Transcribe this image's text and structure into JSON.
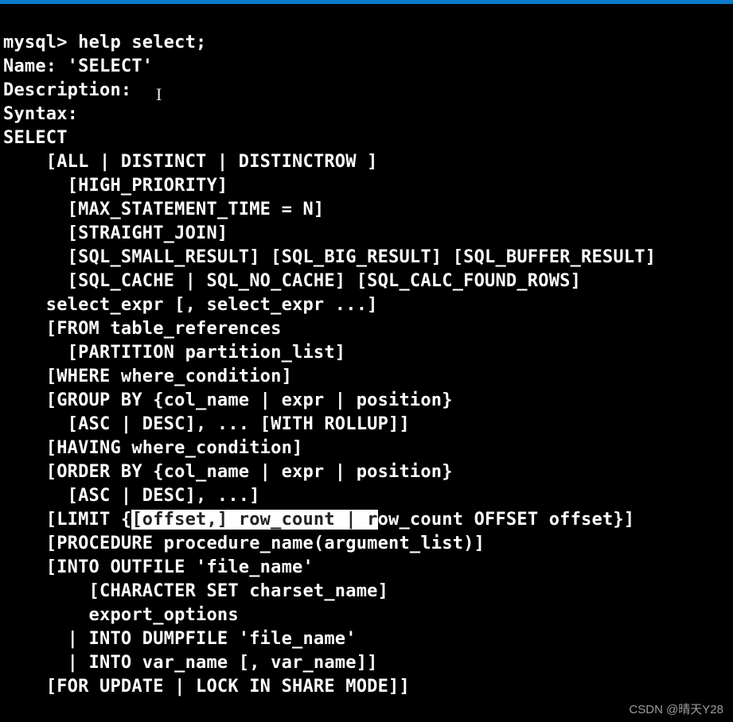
{
  "topbar_color": "#0a7bcc",
  "prompt": "mysql> ",
  "command": "help select;",
  "name_line": "Name: 'SELECT'",
  "description_line": "Description:",
  "syntax_line": "Syntax:",
  "select_kw": "SELECT",
  "lines": {
    "l1": "    [ALL | DISTINCT | DISTINCTROW ]",
    "l2": "      [HIGH_PRIORITY]",
    "l3": "      [MAX_STATEMENT_TIME = N]",
    "l4": "      [STRAIGHT_JOIN]",
    "l5": "      [SQL_SMALL_RESULT] [SQL_BIG_RESULT] [SQL_BUFFER_RESULT]",
    "l6": "      [SQL_CACHE | SQL_NO_CACHE] [SQL_CALC_FOUND_ROWS]",
    "l7": "    select_expr [, select_expr ...]",
    "l8": "    [FROM table_references",
    "l9": "      [PARTITION partition_list]",
    "l10": "    [WHERE where_condition]",
    "l11": "    [GROUP BY {col_name | expr | position}",
    "l12": "      [ASC | DESC], ... [WITH ROLLUP]]",
    "l13": "    [HAVING where_condition]",
    "l14": "    [ORDER BY {col_name | expr | position}",
    "l15": "      [ASC | DESC], ...]",
    "l16a": "    [LIMIT {",
    "l16b": "[offset,] row_count | r",
    "l16c": "ow_count OFFSET offset}]",
    "l17": "    [PROCEDURE procedure_name(argument_list)]",
    "l18": "    [INTO OUTFILE 'file_name'",
    "l19": "        [CHARACTER SET charset_name]",
    "l20": "        export_options",
    "l21": "      | INTO DUMPFILE 'file_name'",
    "l22": "      | INTO var_name [, var_name]]",
    "l23": "    [FOR UPDATE | LOCK IN SHARE MODE]]"
  },
  "cursor_glyph": "I",
  "watermark": "CSDN @晴天Y28"
}
